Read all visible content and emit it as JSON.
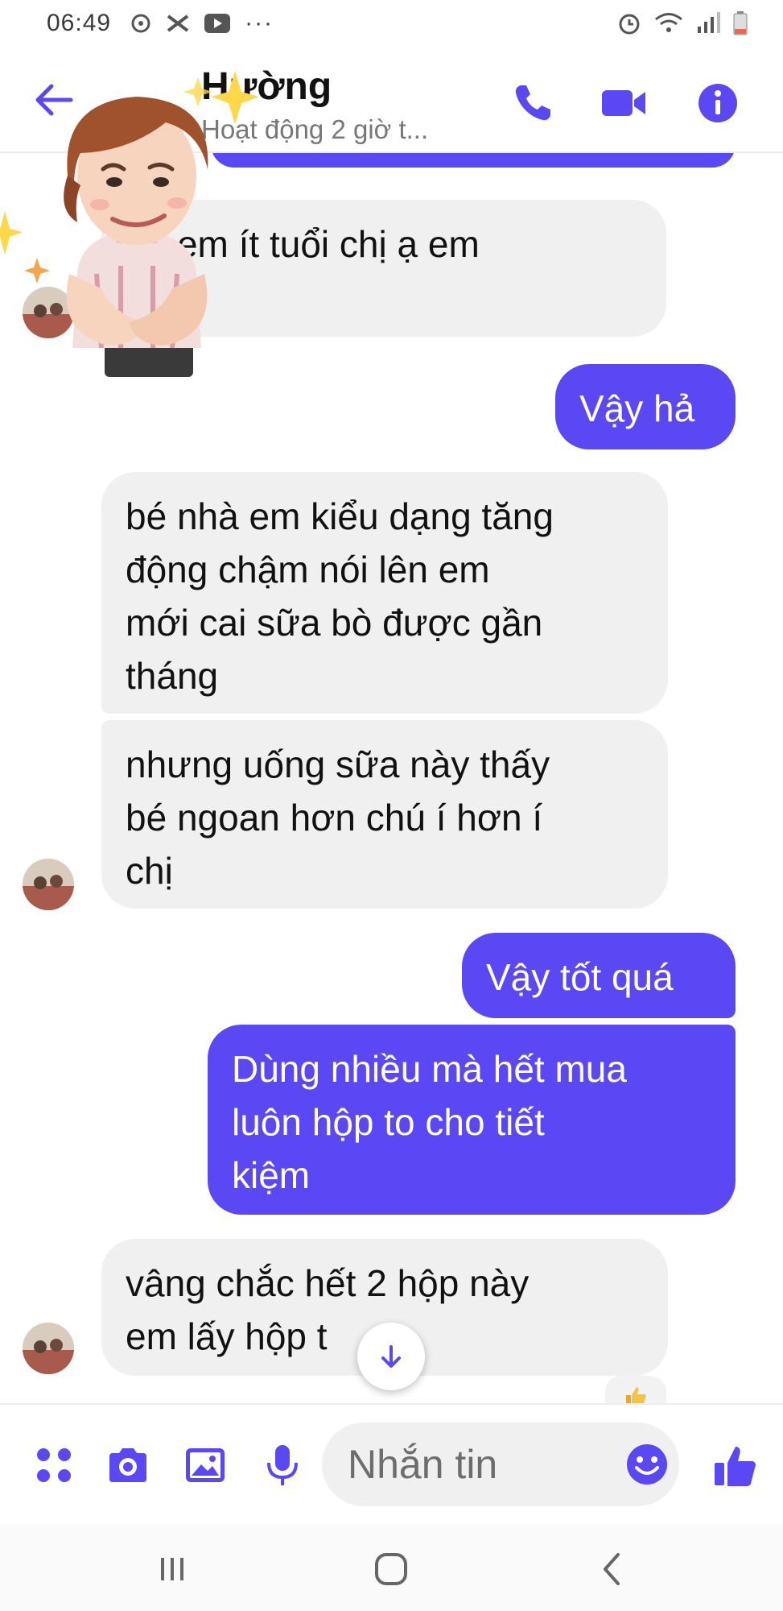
{
  "status_bar": {
    "time": "06:49"
  },
  "header": {
    "contact_name": "Hường",
    "contact_status": "Hoạt động 2 giờ t..."
  },
  "messages": [
    {
      "direction": "in",
      "text": "ng em ít tuổi chị ạ em\n9 ia"
    },
    {
      "direction": "out",
      "text": "Vậy hả"
    },
    {
      "direction": "in",
      "text": "bé nhà em kiểu dạng tăng\nđộng chậm nói lên em\nmới cai sữa bò được gần\ntháng"
    },
    {
      "direction": "in",
      "text": "nhưng uống sữa này thấy\nbé ngoan hơn chú í hơn í\nchị"
    },
    {
      "direction": "out",
      "text": "Vậy tốt quá"
    },
    {
      "direction": "out",
      "text": "Dùng nhiều mà hết mua\nluôn hộp to cho tiết\nkiệm"
    },
    {
      "direction": "in",
      "text": "vâng chắc hết 2 hộp này\nem lấy hộp t"
    }
  ],
  "composer": {
    "placeholder": "Nhắn tin"
  },
  "colors": {
    "accent": "#5a48f5",
    "incoming_bubble": "#f0f0f0"
  },
  "icons": {
    "header": [
      "back-arrow-icon",
      "phone-icon",
      "video-call-icon",
      "info-icon"
    ],
    "composer": [
      "apps-icon",
      "camera-icon",
      "image-icon",
      "microphone-icon",
      "emoji-icon",
      "thumbs-up-icon"
    ],
    "nav": [
      "recent-apps-icon",
      "home-icon",
      "back-icon"
    ]
  }
}
